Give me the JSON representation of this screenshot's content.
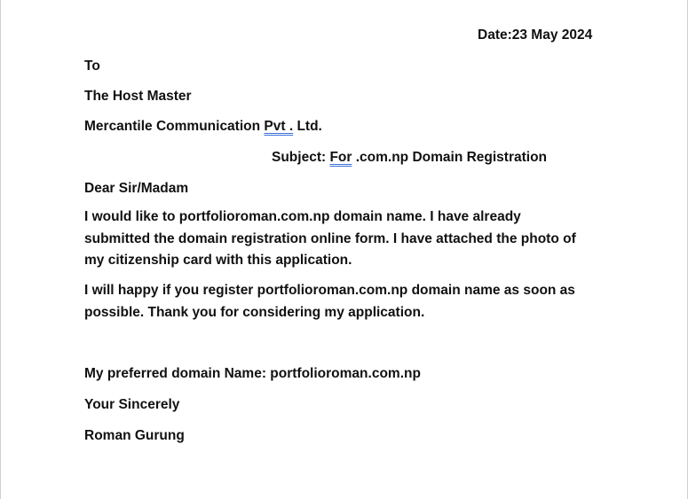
{
  "letter": {
    "date": "Date:23 May 2024",
    "to": "To",
    "recipient": "The Host Master",
    "company": {
      "prefix": "Mercantile Communication ",
      "flagged": "Pvt .",
      "suffix": " Ltd."
    },
    "subject": {
      "prefix": "Subject: ",
      "flagged": "For",
      "suffix": " .com.np Domain Registration"
    },
    "salutation": "Dear Sir/Madam",
    "paragraph1": [
      "I would like to portfolioroman.com.np domain name. I have already",
      "submitted the domain registration online form. I have attached the photo of",
      "my citizenship card with this application."
    ],
    "paragraph2": [
      "I will happy if you register portfolioroman.com.np domain name as soon as",
      "possible. Thank you for considering my application."
    ],
    "preferred_domain": "My preferred domain Name: portfolioroman.com.np",
    "closing": "Your Sincerely",
    "signature": "Roman Gurung"
  },
  "colors": {
    "text": "#111111",
    "grammar_underline": "#3b6fd8"
  }
}
